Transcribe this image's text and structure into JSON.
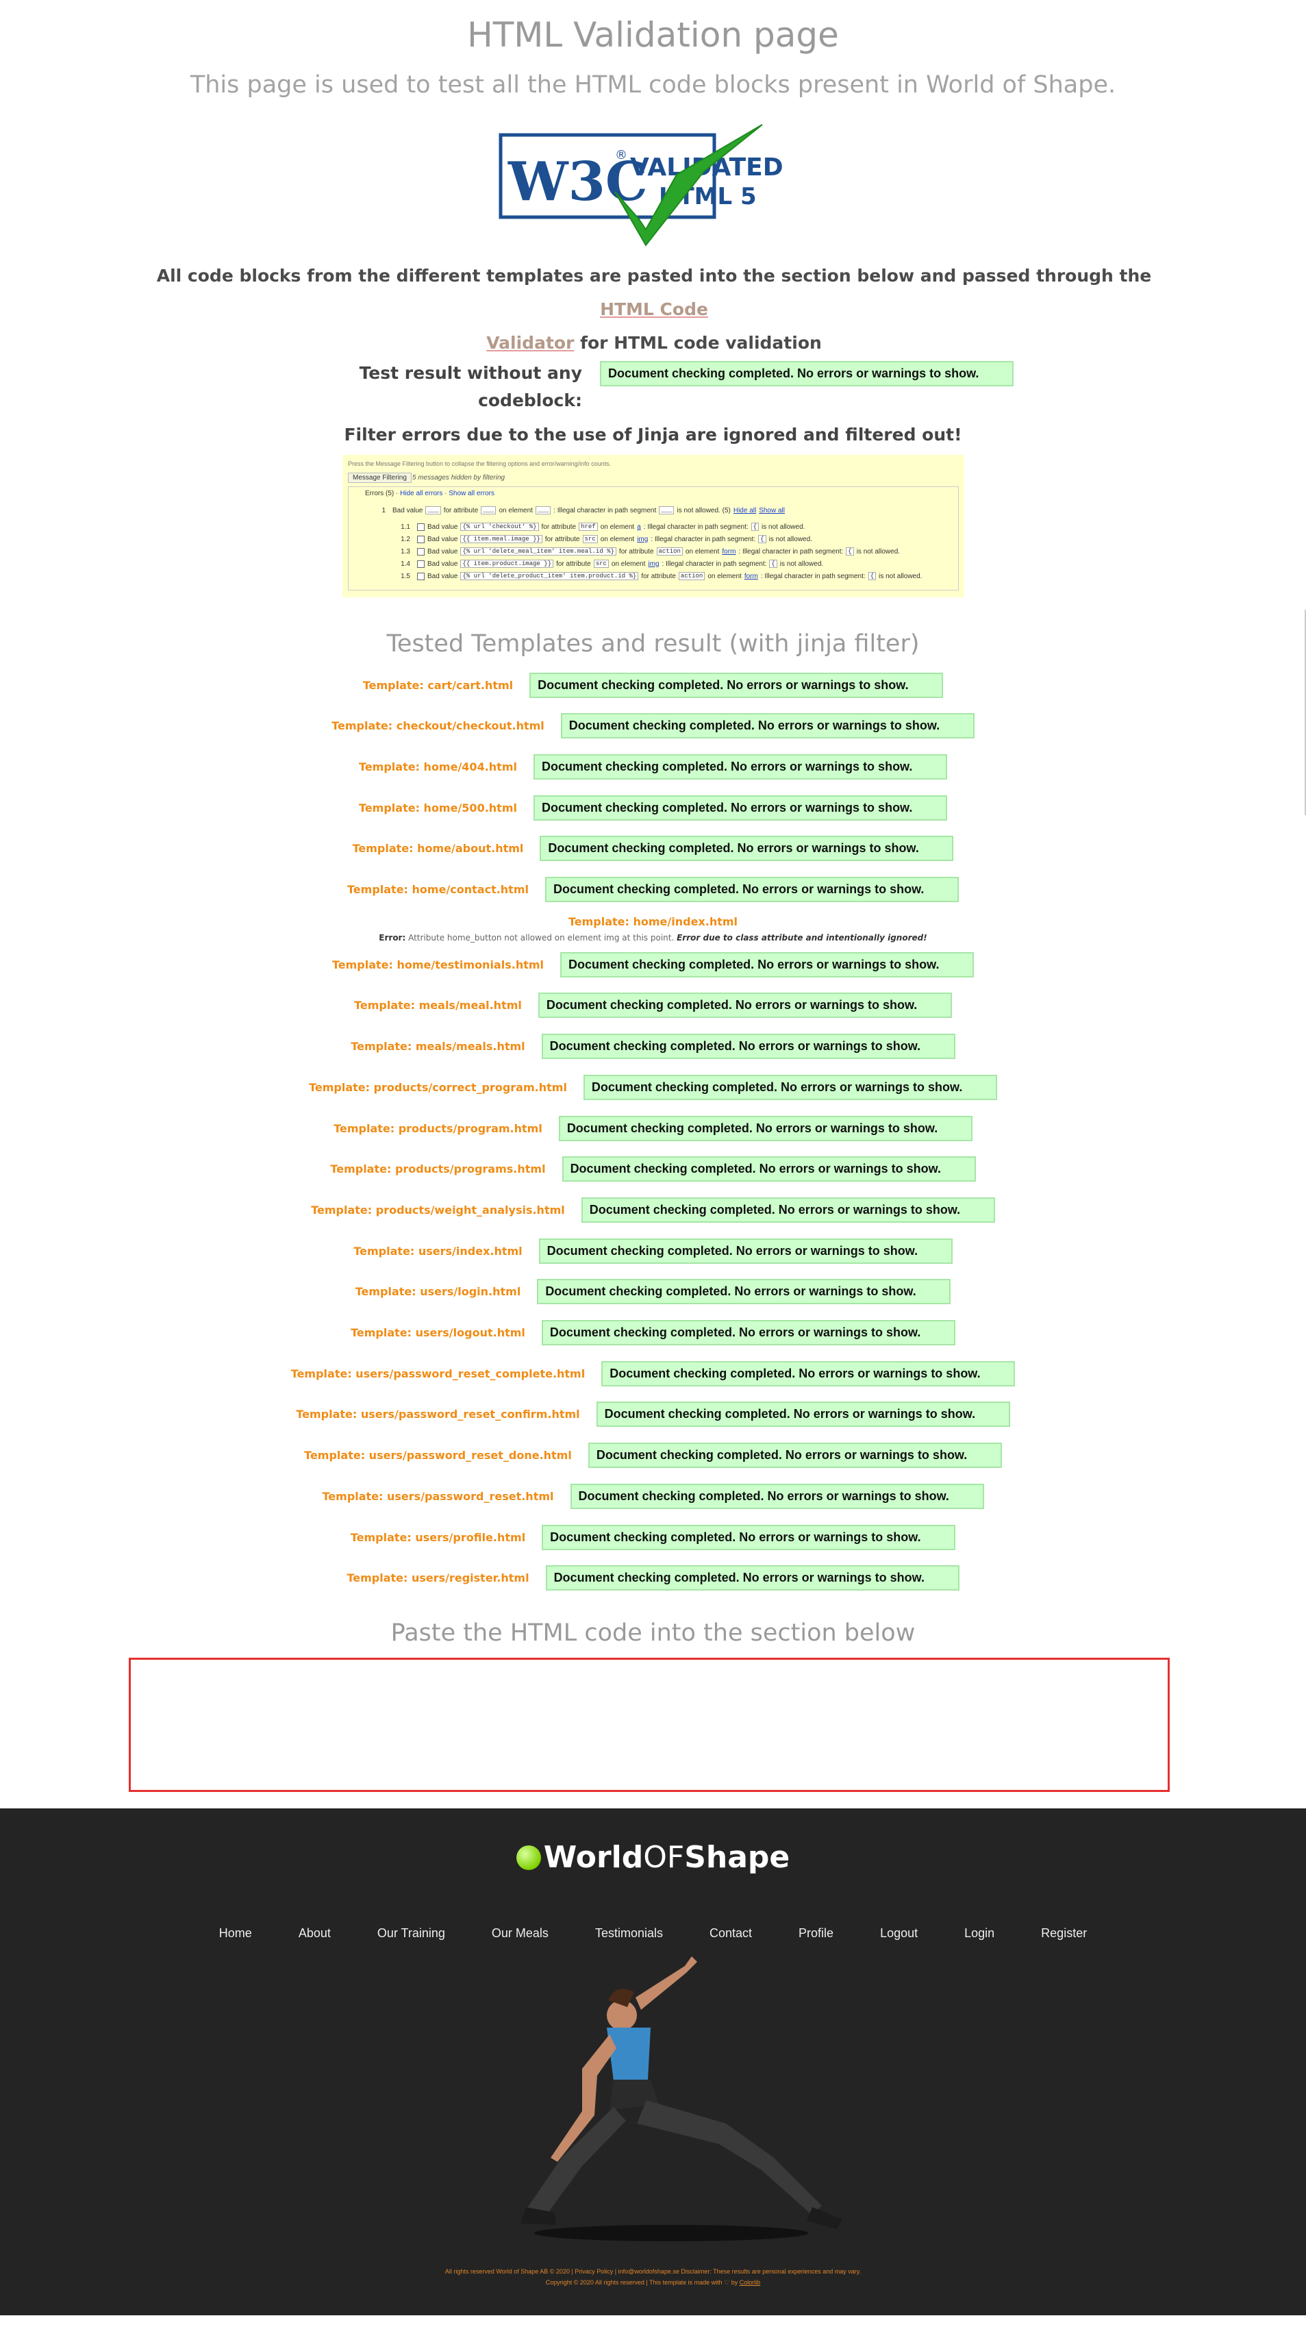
{
  "header": {
    "title": "HTML Validation page",
    "subtitle": "This page is used to test all the HTML code blocks present in World of Shape.",
    "badge": {
      "brand": "W3C",
      "reg": "®",
      "line1": "VALIDATED",
      "line2": "HTML 5"
    }
  },
  "intro": {
    "text_before": "All code blocks from the different templates are pasted into the section below and passed through the ",
    "link_line1": "HTML Code",
    "link_line2": "Validator",
    "text_after": " for HTML code validation"
  },
  "no_codeblock": {
    "label": "Test result without any codeblock:",
    "result": "Document checking completed. No errors or warnings to show."
  },
  "jinja": {
    "heading": "Filter errors due to the use of Jinja are ignored and filtered out!",
    "panel": {
      "hint": "Press the Message Filtering button to collapse the filtering options and error/warning/info counts.",
      "tab": "Message Filtering",
      "hidden_note": "5 messages hidden by filtering",
      "errors_label": "Errors (5) ·",
      "hide_all": "Hide all errors",
      "show_all": "Show all errors",
      "group": {
        "num": "1",
        "text": "Bad value",
        "tail": "is not allowed. (5)",
        "hide": "Hide all",
        "show": "Show all"
      },
      "rows": [
        {
          "num": "1.1",
          "value": "{% url 'checkout' %}",
          "attr": "href",
          "element": "a"
        },
        {
          "num": "1.2",
          "value": "{{ item.meal.image }}",
          "attr": "src",
          "element": "img"
        },
        {
          "num": "1.3",
          "value": "{% url 'delete_meal_item' item.meal.id %}",
          "attr": "action",
          "element": "form"
        },
        {
          "num": "1.4",
          "value": "{{ item.product.image }}",
          "attr": "src",
          "element": "img"
        },
        {
          "num": "1.5",
          "value": "{% url 'delete_product_item' item.product.id %}",
          "attr": "action",
          "element": "form"
        }
      ]
    }
  },
  "tested": {
    "heading": "Tested Templates and result (with jinja filter)",
    "result_text": "Document checking completed. No errors or warnings to show.",
    "templates": [
      "Template: cart/cart.html",
      "Template: checkout/checkout.html",
      "Template: home/404.html",
      "Template: home/500.html",
      "Template: home/about.html",
      "Template: home/contact.html"
    ],
    "index_template": {
      "title": "Template: home/index.html",
      "error_label": "Error:",
      "error_text": " Attribute home_button not allowed on element img at this point. ",
      "error_note": "Error due to class attribute and intentionally ignored!"
    },
    "templates_after": [
      "Template: home/testimonials.html",
      "Template: meals/meal.html",
      "Template: meals/meals.html",
      "Template: products/correct_program.html",
      "Template: products/program.html",
      "Template: products/programs.html",
      "Template: products/weight_analysis.html",
      "Template: users/index.html",
      "Template: users/login.html",
      "Template: users/logout.html",
      "Template: users/password_reset_complete.html",
      "Template: users/password_reset_confirm.html",
      "Template: users/password_reset_done.html",
      "Template: users/password_reset.html",
      "Template: users/profile.html",
      "Template: users/register.html"
    ]
  },
  "paste": {
    "heading": "Paste the HTML code into the section below"
  },
  "footer": {
    "logo_world": "World",
    "logo_of": "OF",
    "logo_shape": "Shape",
    "nav": [
      "Home",
      "About",
      "Our Training",
      "Our Meals",
      "Testimonials",
      "Contact",
      "Profile",
      "Logout",
      "Login",
      "Register"
    ],
    "legal_line1": "All rights reserved World of Shape AB © 2020 | Privacy Policy | info@worldofshape.se Disclaimer: These results are personal experiences and may vary.",
    "legal_line2_before": "Copyright © 2020 All rights reserved | This template is made with ♡ by ",
    "legal_link": "Colorlib"
  },
  "colors": {
    "accent": "#f08c16",
    "result_bg": "#ccffcc",
    "paste_border": "#e53030",
    "footer_bg": "#242424"
  }
}
